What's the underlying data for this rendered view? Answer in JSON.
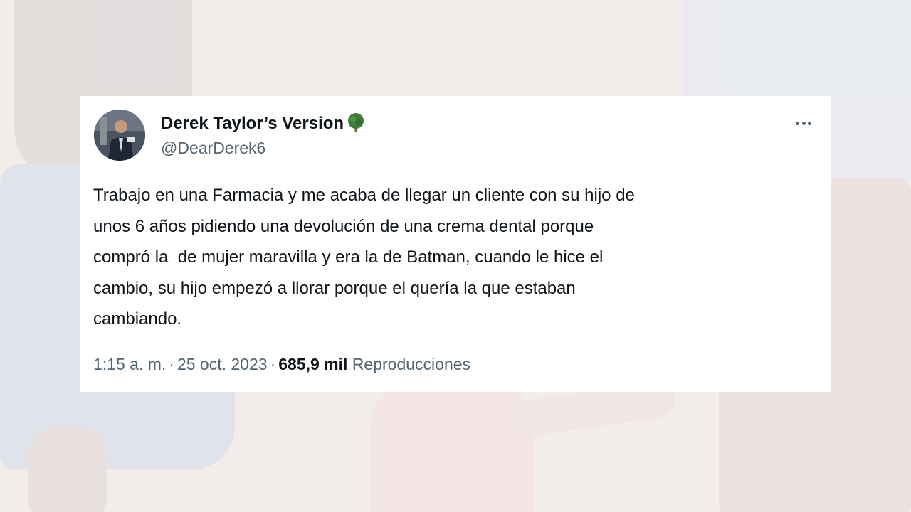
{
  "tweet": {
    "display_name": "Derek Taylor’s Version",
    "badge_icon": "tree-icon",
    "handle": "@DearDerek6",
    "text_lines": [
      "Trabajo en una Farmacia y me acaba de llegar un cliente con su hijo de",
      "unos 6 años pidiendo una devolución de una crema dental porque",
      "compró la  de mujer maravilla y era la de Batman, cuando le hice el",
      "cambio, su hijo empezó a llorar porque el quería la que estaban",
      "cambiando."
    ],
    "time": "1:15 a. m.",
    "separator": "·",
    "date": "25 oct. 2023",
    "views_count": "685,9 mil",
    "views_label": "Reproducciones",
    "more_icon": "more-horizontal-icon"
  },
  "colors": {
    "text_primary": "#0f1419",
    "text_secondary": "#536471",
    "card_background": "#ffffff",
    "tree_green": "#3e7d36"
  }
}
